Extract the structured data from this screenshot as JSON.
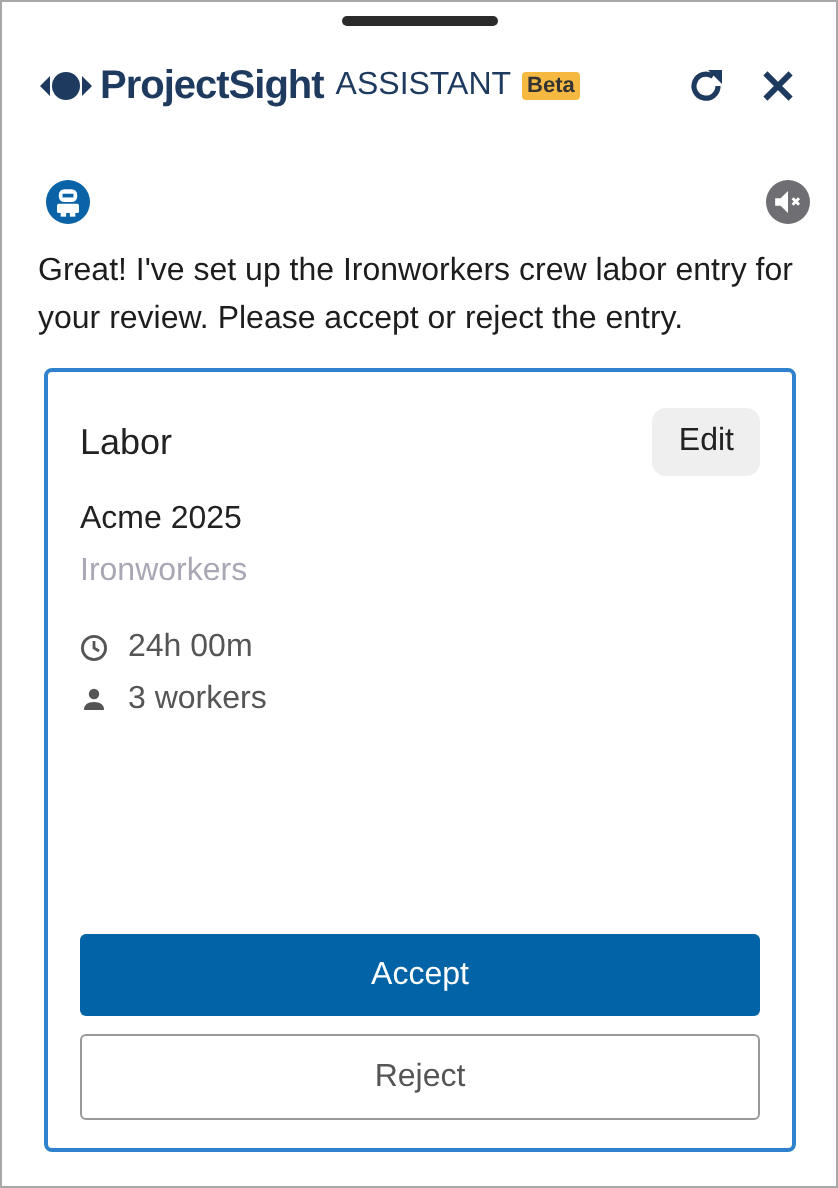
{
  "header": {
    "brand": "ProjectSight",
    "product": "ASSISTANT",
    "badge": "Beta"
  },
  "message": "Great! I've set up the Ironworkers crew labor entry for your review. Please accept or reject the entry.",
  "card": {
    "title": "Labor",
    "edit_label": "Edit",
    "project": "Acme 2025",
    "crew": "Ironworkers",
    "details": [
      {
        "kind": "time",
        "text": "24h 00m"
      },
      {
        "kind": "workers",
        "text": "3 workers"
      }
    ],
    "accept_label": "Accept",
    "reject_label": "Reject"
  }
}
